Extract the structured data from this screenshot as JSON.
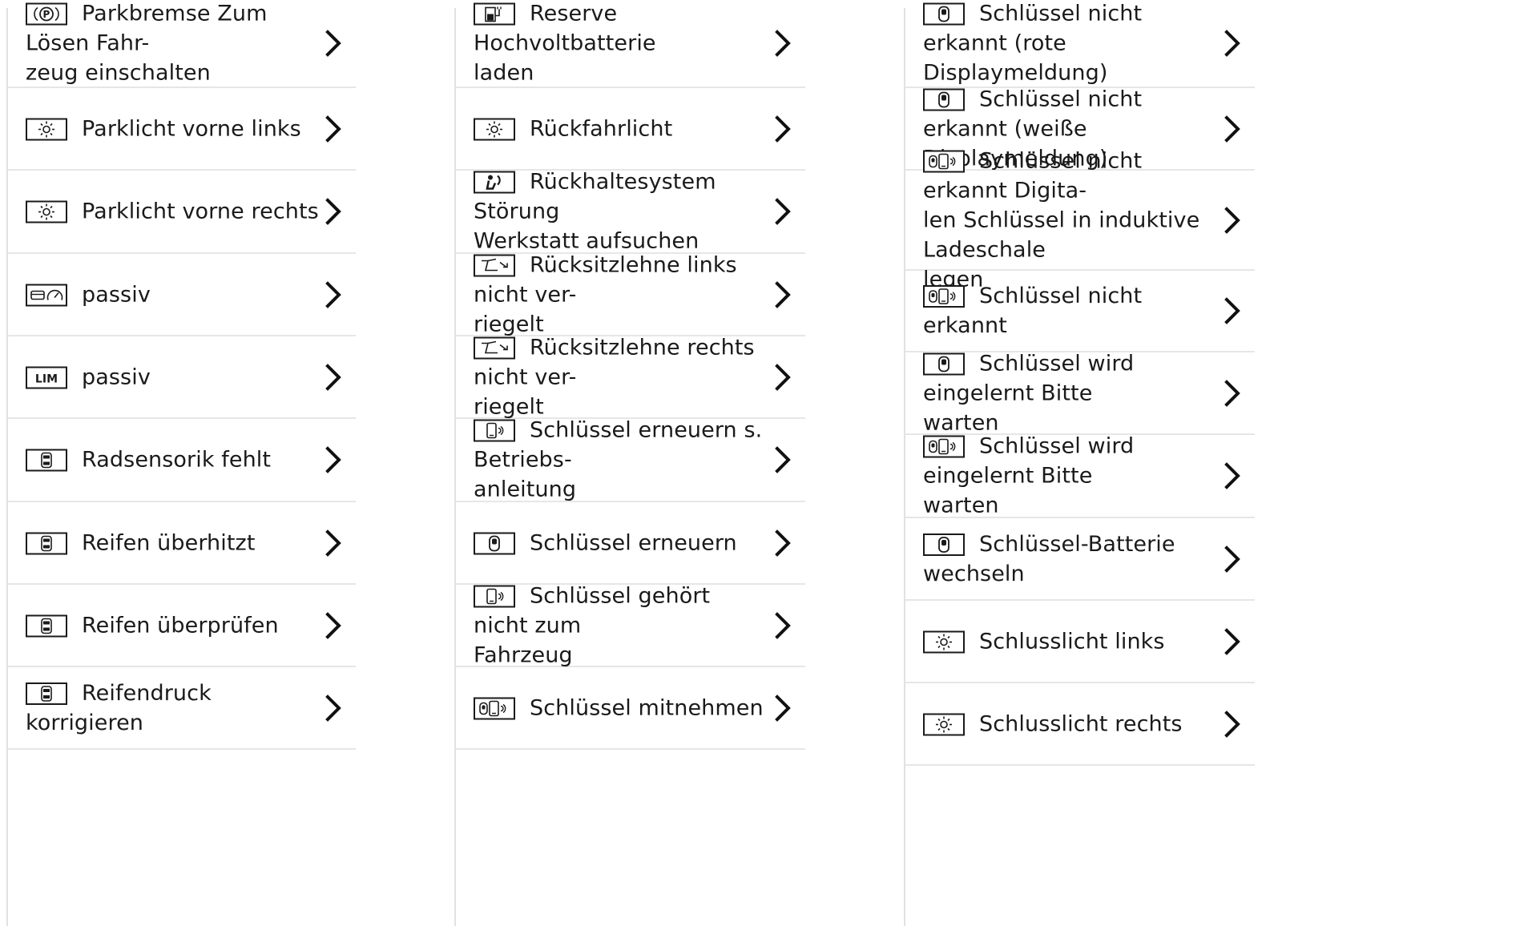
{
  "columns": [
    {
      "items": [
        {
          "icon": "parking-brake-icon",
          "label": "Parkbremse Zum Lösen Fahr-\nzeug einschalten"
        },
        {
          "icon": "light-icon",
          "label": "Parklicht vorne links"
        },
        {
          "icon": "light-icon",
          "label": "Parklicht vorne rechts"
        },
        {
          "icon": "distance-assist-icon",
          "label": "passiv"
        },
        {
          "icon": "lim-icon",
          "label": "passiv"
        },
        {
          "icon": "tire-pressure-icon",
          "label": "Radsensorik fehlt"
        },
        {
          "icon": "tire-pressure-icon",
          "label": "Reifen überhitzt"
        },
        {
          "icon": "tire-pressure-icon",
          "label": "Reifen überprüfen"
        },
        {
          "icon": "tire-pressure-icon",
          "label": "Reifendruck korrigieren"
        }
      ]
    },
    {
      "items": [
        {
          "icon": "charging-icon",
          "label": "Reserve Hochvoltbatterie\nladen"
        },
        {
          "icon": "light-icon",
          "label": "Rückfahrlicht"
        },
        {
          "icon": "airbag-icon",
          "label": "Rückhaltesystem Störung\nWerkstatt aufsuchen"
        },
        {
          "icon": "seat-backrest-icon",
          "label": "Rücksitzlehne links nicht ver-\nriegelt"
        },
        {
          "icon": "seat-backrest-icon",
          "label": "Rücksitzlehne rechts nicht ver-\nriegelt"
        },
        {
          "icon": "phone-key-icon",
          "label": "Schlüssel erneuern s. Betriebs-\nanleitung"
        },
        {
          "icon": "key-icon",
          "label": "Schlüssel erneuern"
        },
        {
          "icon": "phone-key-icon",
          "label": "Schlüssel gehört nicht zum\nFahrzeug"
        },
        {
          "icon": "key-phone-icon",
          "label": "Schlüssel mitnehmen"
        }
      ]
    },
    {
      "items": [
        {
          "icon": "key-icon",
          "label": "Schlüssel nicht erkannt (rote\nDisplaymeldung)"
        },
        {
          "icon": "key-icon",
          "label": "Schlüssel nicht erkannt (weiße\nDisplaymeldung)"
        },
        {
          "icon": "key-phone-icon",
          "label": "Schlüssel nicht erkannt Digita-\nlen Schlüssel in induktive Ladeschale\nlegen"
        },
        {
          "icon": "key-phone-icon",
          "label": "Schlüssel nicht erkannt"
        },
        {
          "icon": "key-icon",
          "label": "Schlüssel wird eingelernt Bitte\nwarten"
        },
        {
          "icon": "key-phone-icon",
          "label": "Schlüssel wird eingelernt Bitte\nwarten"
        },
        {
          "icon": "key-icon",
          "label": "Schlüssel-Batterie wechseln"
        },
        {
          "icon": "light-icon",
          "label": "Schlusslicht links"
        },
        {
          "icon": "light-icon",
          "label": "Schlusslicht rechts"
        }
      ]
    }
  ],
  "chevron_icon": "chevron-right-icon",
  "colors": {
    "text": "#1a1a1a",
    "divider": "#e6e6e6",
    "background": "#ffffff"
  }
}
